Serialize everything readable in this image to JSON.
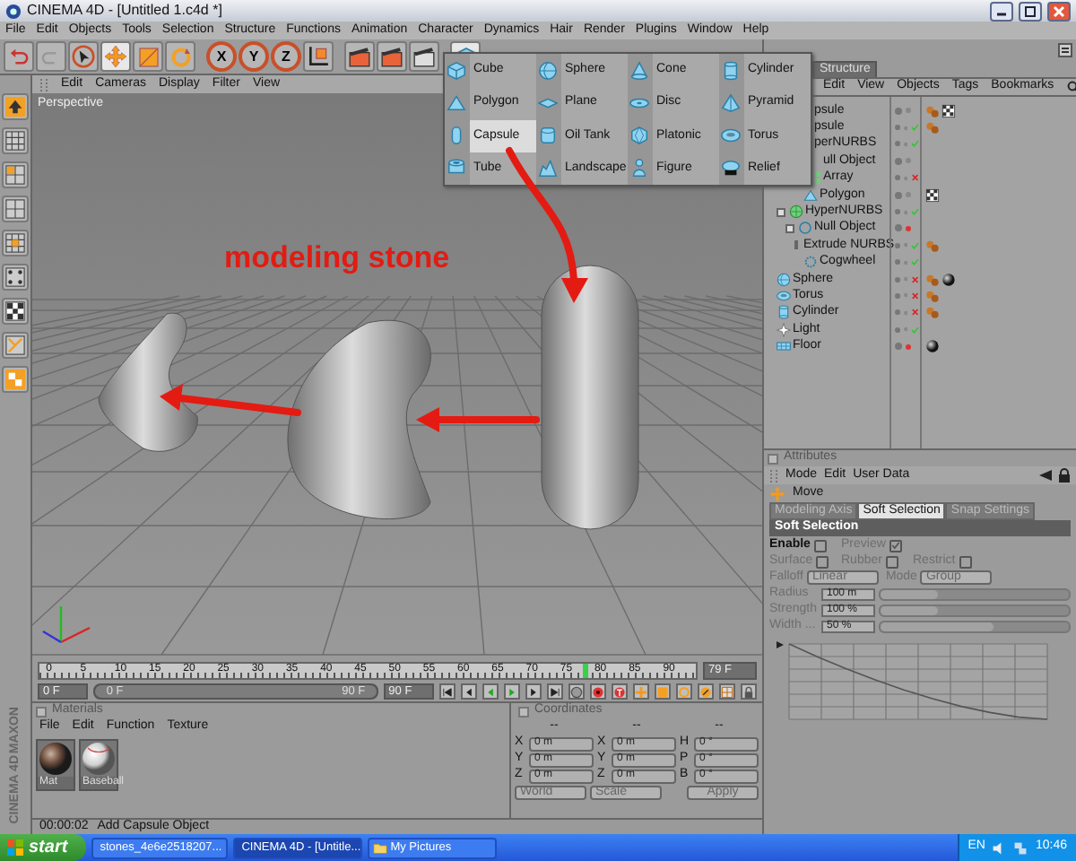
{
  "window": {
    "title": "CINEMA 4D - [Untitled 1.c4d *]"
  },
  "menu": [
    "File",
    "Edit",
    "Objects",
    "Tools",
    "Selection",
    "Structure",
    "Functions",
    "Animation",
    "Character",
    "Dynamics",
    "Hair",
    "Render",
    "Plugins",
    "Window",
    "Help"
  ],
  "axis_buttons": [
    "X",
    "Y",
    "Z"
  ],
  "viewport": {
    "menu": [
      "Edit",
      "Cameras",
      "Display",
      "Filter",
      "View"
    ],
    "label": "Perspective",
    "annotation": "modeling stone"
  },
  "primitives_menu": [
    {
      "label": "Cube",
      "kind": "cube",
      "selected": false
    },
    {
      "label": "Sphere",
      "kind": "sphere",
      "selected": false
    },
    {
      "label": "Cone",
      "kind": "cone",
      "selected": false
    },
    {
      "label": "Cylinder",
      "kind": "cylinder",
      "selected": false
    },
    {
      "label": "Polygon",
      "kind": "polygon",
      "selected": false
    },
    {
      "label": "Plane",
      "kind": "plane",
      "selected": false
    },
    {
      "label": "Disc",
      "kind": "disc",
      "selected": false
    },
    {
      "label": "Pyramid",
      "kind": "pyramid",
      "selected": false
    },
    {
      "label": "Capsule",
      "kind": "capsule",
      "selected": true
    },
    {
      "label": "Oil Tank",
      "kind": "oiltank",
      "selected": false
    },
    {
      "label": "Platonic",
      "kind": "platonic",
      "selected": false
    },
    {
      "label": "Torus",
      "kind": "torus",
      "selected": false
    },
    {
      "label": "Tube",
      "kind": "tube",
      "selected": false
    },
    {
      "label": "Landscape",
      "kind": "landscape",
      "selected": false
    },
    {
      "label": "Figure",
      "kind": "figure",
      "selected": false
    },
    {
      "label": "Relief",
      "kind": "relief",
      "selected": false
    }
  ],
  "object_manager": {
    "tabs": [
      {
        "label": "Structure",
        "selected": false
      }
    ],
    "menu": [
      "Edit",
      "View",
      "Objects",
      "Tags",
      "Bookmarks"
    ],
    "objects": [
      {
        "name": "psule",
        "visible": true,
        "tags": [
          {
            "kind": "phong"
          },
          {
            "kind": "uv"
          }
        ]
      },
      {
        "name": "psule",
        "enabled": true,
        "visible": true,
        "tags": [
          {
            "kind": "phong"
          }
        ]
      },
      {
        "name": "perNURBS",
        "enabled": true,
        "visible": true,
        "children": [
          {
            "name": "ull Object",
            "visible": true,
            "children": [
              {
                "name": "Array",
                "kind": "array",
                "enabled": false,
                "visible": true,
                "children": [
                  {
                    "name": "Polygon",
                    "kind": "polygon",
                    "visible": true,
                    "tags": [
                      {
                        "kind": "uv"
                      }
                    ]
                  }
                ]
              }
            ]
          }
        ]
      },
      {
        "name": "HyperNURBS",
        "kind": "nurbs",
        "enabled": true,
        "visible": true,
        "children": [
          {
            "name": "Null Object",
            "kind": "null",
            "visible": false,
            "children": [
              {
                "name": "Extrude NURBS",
                "kind": "extrude",
                "enabled": true,
                "visible": true,
                "tags": [
                  {
                    "kind": "phong"
                  }
                ],
                "children": [
                  {
                    "name": "Cogwheel",
                    "kind": "cogwheel",
                    "enabled": true,
                    "visible": true
                  }
                ]
              }
            ]
          }
        ]
      },
      {
        "name": "Sphere",
        "kind": "sphere",
        "enabled": false,
        "visible": true,
        "tags": [
          {
            "kind": "phong"
          },
          {
            "kind": "material"
          }
        ]
      },
      {
        "name": "Torus",
        "kind": "torus",
        "enabled": false,
        "visible": true,
        "tags": [
          {
            "kind": "phong"
          }
        ]
      },
      {
        "name": "Cylinder",
        "kind": "cylinder",
        "enabled": false,
        "visible": true,
        "tags": [
          {
            "kind": "phong"
          }
        ]
      },
      {
        "name": "Light",
        "kind": "light",
        "enabled": true,
        "visible": true
      },
      {
        "name": "Floor",
        "kind": "floor",
        "visible": false,
        "tags": [
          {
            "kind": "material"
          }
        ]
      }
    ]
  },
  "attributes": {
    "title": "Attributes",
    "menu": [
      "Mode",
      "Edit",
      "User Data"
    ],
    "tool": "Move",
    "tabs": [
      {
        "label": "Modeling Axis",
        "selected": false
      },
      {
        "label": "Soft Selection",
        "selected": true
      },
      {
        "label": "Snap Settings",
        "selected": false
      }
    ],
    "section": "Soft Selection",
    "options": [
      {
        "label": "Enable",
        "checked": false,
        "disabled": false
      },
      {
        "label": "Preview",
        "checked": true,
        "disabled": true
      },
      {
        "label": "Surface",
        "checked": false,
        "disabled": true
      },
      {
        "label": "Rubber",
        "checked": false,
        "disabled": true
      },
      {
        "label": "Restrict",
        "checked": false,
        "disabled": true
      }
    ],
    "dropdowns": [
      {
        "label": "Falloff",
        "value": "Linear"
      },
      {
        "label": "Mode",
        "value": "Group"
      }
    ],
    "sliders": [
      {
        "label": "Radius",
        "value": "100 m",
        "level": 0.3
      },
      {
        "label": "Strength",
        "value": "100 %",
        "level": 0.3
      },
      {
        "label": "Width ...",
        "value": "50 %",
        "level": 0.6
      }
    ]
  },
  "timeline": {
    "ticks": [
      "0",
      "5",
      "10",
      "15",
      "20",
      "25",
      "30",
      "35",
      "40",
      "45",
      "50",
      "55",
      "60",
      "65",
      "70",
      "75",
      "80",
      "85",
      "90"
    ],
    "level": 0.878,
    "frame": "79 F"
  },
  "transport": {
    "start": "0 F",
    "range_start": "0 F",
    "range_end": "90 F",
    "level": 1,
    "end": "90 F"
  },
  "materials": {
    "title": "Materials",
    "menu": [
      "File",
      "Edit",
      "Function",
      "Texture"
    ],
    "items": [
      {
        "name": "Mat",
        "kind": "rough"
      },
      {
        "name": "Baseball",
        "kind": "baseball"
      }
    ]
  },
  "coordinates": {
    "title": "Coordinates",
    "headers": [
      "--",
      "--",
      "--"
    ],
    "rows": [
      [
        {
          "label": "X",
          "value": "0 m"
        },
        {
          "label": "X",
          "value": "0 m"
        },
        {
          "label": "H",
          "value": "0 °"
        }
      ],
      [
        {
          "label": "Y",
          "value": "0 m"
        },
        {
          "label": "Y",
          "value": "0 m"
        },
        {
          "label": "P",
          "value": "0 °"
        }
      ],
      [
        {
          "label": "Z",
          "value": "0 m"
        },
        {
          "label": "Z",
          "value": "0 m"
        },
        {
          "label": "B",
          "value": "0 °"
        }
      ]
    ],
    "dropdowns": [
      "World",
      "Scale"
    ],
    "button": "Apply"
  },
  "status": {
    "time": "00:00:02",
    "message": "Add Capsule Object"
  },
  "logo": [
    "MAXON",
    "CINEMA 4D"
  ],
  "taskbar": {
    "start": "start",
    "tasks": [
      {
        "label": "stones_4e6e2518207...",
        "kind": "browser",
        "selected": false
      },
      {
        "label": "CINEMA 4D - [Untitle...",
        "kind": "app",
        "selected": true
      },
      {
        "label": "My Pictures",
        "kind": "folder",
        "selected": false
      }
    ],
    "language": "EN",
    "clock": "10:46"
  }
}
